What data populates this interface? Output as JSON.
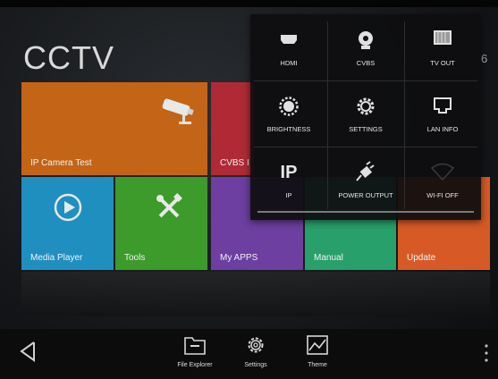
{
  "home": {
    "title": "CCTV",
    "corner_digit": "6"
  },
  "tiles": {
    "ip_camera": "IP Camera Test",
    "cvbs": "CVBS I",
    "media_player": "Media Player",
    "tools": "Tools",
    "my_apps": "My APPS",
    "manual": "Manual",
    "update": "Update"
  },
  "dock": {
    "file_explorer": "File Explorer",
    "settings": "Settings",
    "theme": "Theme"
  },
  "quick_panel": {
    "items": [
      {
        "label": "HDMI",
        "icon": "hdmi-icon"
      },
      {
        "label": "CVBS",
        "icon": "cvbs-camera-icon"
      },
      {
        "label": "TV OUT",
        "icon": "tv-out-icon"
      },
      {
        "label": "BRIGHTNESS",
        "icon": "brightness-icon"
      },
      {
        "label": "SETTINGS",
        "icon": "gear-icon"
      },
      {
        "label": "LAN INFO",
        "icon": "lan-icon"
      },
      {
        "label": "IP",
        "icon": "ip-icon"
      },
      {
        "label": "POWER OUTPUT",
        "icon": "power-plug-icon"
      },
      {
        "label": "WI-FI OFF",
        "icon": "wifi-icon"
      }
    ],
    "ip_glyph": "IP"
  },
  "colors": {
    "ip_camera": "#c46417",
    "cvbs": "#b02a35",
    "media_player": "#1f8fc0",
    "tools": "#3c9b2b",
    "my_apps": "#6c3fa0",
    "manual": "#27a06b",
    "update": "#d75a26"
  }
}
